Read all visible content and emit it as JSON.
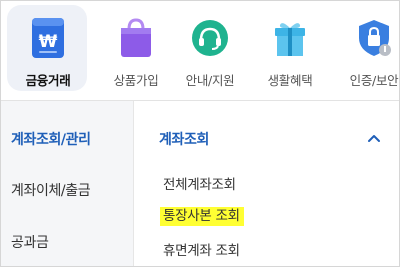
{
  "top_nav": {
    "categories": [
      {
        "label": "금융거래",
        "icon": "banking-icon",
        "selected": true
      },
      {
        "label": "상품가입",
        "icon": "shopping-bag-icon",
        "selected": false
      },
      {
        "label": "안내/지원",
        "icon": "headset-icon",
        "selected": false
      },
      {
        "label": "생활혜택",
        "icon": "gift-icon",
        "selected": false
      },
      {
        "label": "인증/보안",
        "icon": "shield-icon",
        "selected": false
      }
    ]
  },
  "left_menu": {
    "items": [
      {
        "label": "계좌조회/관리",
        "active": true
      },
      {
        "label": "계좌이체/출금",
        "active": false
      },
      {
        "label": "공과금",
        "active": false
      }
    ]
  },
  "submenu": {
    "title": "계좌조회",
    "expand_icon": "chevron-up-icon",
    "items": [
      {
        "label": "전체계좌조회",
        "highlighted": false
      },
      {
        "label": "통장사본 조회",
        "highlighted": true
      },
      {
        "label": "휴면계좌 조회",
        "highlighted": false
      }
    ]
  },
  "colors": {
    "accent": "#1f5fb8",
    "highlight": "#ffff33",
    "selected_bg": "#eef1f7",
    "banking_icon": "#2f6fe0",
    "bag_icon": "#8d5be8",
    "headset_icon": "#1fb38f",
    "gift_icon": "#3db4e6",
    "shield_icon": "#3a7fe0"
  }
}
